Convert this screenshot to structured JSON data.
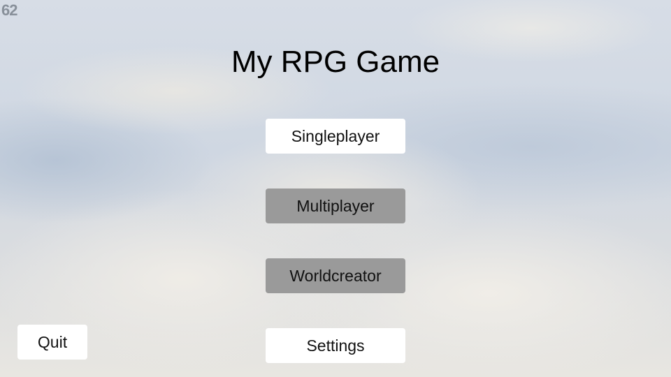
{
  "hud": {
    "fps_counter": "62"
  },
  "menu": {
    "title": "My RPG Game",
    "buttons": {
      "singleplayer": "Singleplayer",
      "multiplayer": "Multiplayer",
      "worldcreator": "Worldcreator",
      "settings": "Settings",
      "quit": "Quit"
    }
  }
}
